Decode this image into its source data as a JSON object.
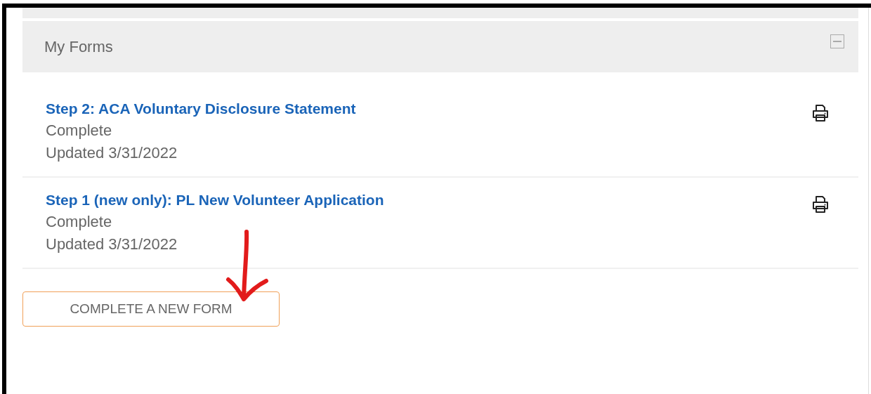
{
  "panel": {
    "title": "My Forms",
    "expanded": true
  },
  "forms": [
    {
      "title": "Step 2: ACA Voluntary Disclosure Statement",
      "status": "Complete",
      "updated": "Updated 3/31/2022"
    },
    {
      "title": "Step 1 (new only): PL New Volunteer Application",
      "status": "Complete",
      "updated": "Updated 3/31/2022"
    }
  ],
  "new_form_button": "COMPLETE A NEW FORM"
}
